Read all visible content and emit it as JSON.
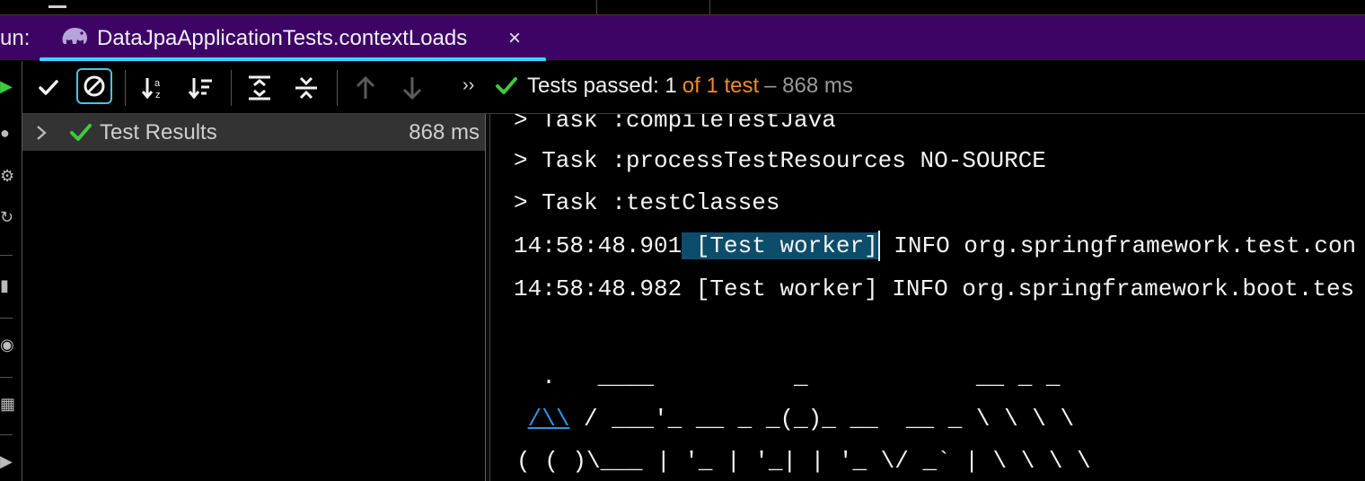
{
  "run_bar": {
    "label": "un:",
    "tab_title": "DataJpaApplicationTests.contextLoads",
    "close_glyph": "×",
    "icon": "gradle-elephant-icon",
    "bg_color": "#3d0466",
    "underline_color": "#3ad7ff"
  },
  "toolbar": {
    "buttons": [
      {
        "name": "show-passed-button",
        "icon": "check-icon"
      },
      {
        "name": "show-ignored-button",
        "icon": "ban-icon",
        "selected": true
      },
      {
        "name": "sort-alphabetically-button",
        "icon": "sort-az-icon"
      },
      {
        "name": "sort-by-duration-button",
        "icon": "sort-duration-icon"
      },
      {
        "name": "expand-all-button",
        "icon": "expand-all-icon"
      },
      {
        "name": "collapse-all-button",
        "icon": "collapse-all-icon"
      },
      {
        "name": "previous-failed-button",
        "icon": "arrow-up-icon"
      },
      {
        "name": "next-failed-button",
        "icon": "arrow-down-icon"
      }
    ],
    "more_glyph": "››"
  },
  "status": {
    "passed_text": "Tests passed: 1",
    "of_text": "of 1 test",
    "duration_text": "– 868 ms",
    "check_color": "#3ccb3c",
    "of_color": "#ef8a2a"
  },
  "tree": {
    "root": {
      "label": "Test Results",
      "time": "868 ms",
      "status": "passed"
    }
  },
  "console": {
    "lines": [
      "> Task :compileTestJava",
      "> Task :processTestResources NO-SOURCE",
      "> Task :testClasses",
      "",
      "14:58:48.982 [Test worker] INFO org.springframework.boot.tes",
      "",
      "  .   ____          _            __ _ _",
      " /\\\\ / ___'_ __ _ _(_)_ __  __ _ \\ \\ \\ \\",
      "( ( )\\___ | '_ | '_| | '_ \\/ _` | \\ \\ \\ \\"
    ],
    "line4_time": "14:58:48.901",
    "line4_worker": " [Test worker]",
    "line4_rest": " INFO org.springframework.test.con",
    "banner_link": "/\\\\",
    "banner_rest": " / ___'_ __ _ _(_)_ __  __ _ \\ \\ \\ \\"
  }
}
